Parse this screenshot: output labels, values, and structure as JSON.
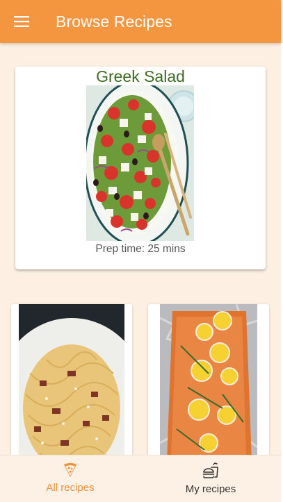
{
  "appbar": {
    "title": "Browse Recipes",
    "menu_icon": "hamburger-menu-icon",
    "background": "#f4963f"
  },
  "featured": {
    "title": "Greek Salad",
    "subtitle": "Prep time: 25 mins"
  },
  "grid": {
    "items": [
      {
        "photo": "spaghetti-carbonara-photo"
      },
      {
        "photo": "baked-salmon-lemon-photo"
      }
    ]
  },
  "bottom_nav": {
    "items": [
      {
        "label": "All recipes",
        "icon": "pizza-slice-icon",
        "active": true,
        "color": "#f0913c"
      },
      {
        "label": "My recipes",
        "icon": "burger-drink-icon",
        "active": false,
        "color": "#333333"
      }
    ]
  }
}
